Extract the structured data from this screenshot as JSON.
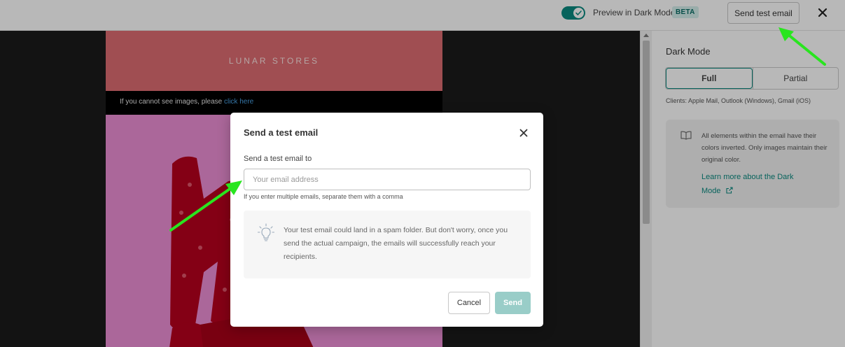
{
  "topbar": {
    "dark_mode_label": "Preview in Dark Mode",
    "beta_badge": "BETA",
    "send_test_label": "Send test email",
    "toggle_state": "on"
  },
  "email_preview": {
    "brand": "LUNAR STORES",
    "images_notice": "If you cannot see images, please ",
    "images_link": "click here"
  },
  "panel": {
    "title": "Dark Mode",
    "modes": [
      "Full",
      "Partial"
    ],
    "selected_mode": "Full",
    "clients": "Clients: Apple Mail, Outlook (Windows), Gmail (iOS)",
    "info_text": "All elements within the email have their colors inverted. Only images maintain their original color.",
    "learn_more": "Learn more about the Dark Mode"
  },
  "modal": {
    "title": "Send a test email",
    "field_label": "Send a test email to",
    "email_value": "",
    "email_placeholder": "Your email address",
    "hint": "If you enter multiple emails, separate them with a comma",
    "tip": "Your test email could land in a spam folder. But don't worry, once you send the actual campaign, the emails will successfully reach your recipients.",
    "cancel_label": "Cancel",
    "send_label": "Send"
  },
  "colors": {
    "accent": "#0b8a80",
    "send_disabled": "#99cdc8",
    "annotation_arrow": "#29e51f",
    "email_header": "#de6c72",
    "email_hero": "#ee8fd6"
  }
}
